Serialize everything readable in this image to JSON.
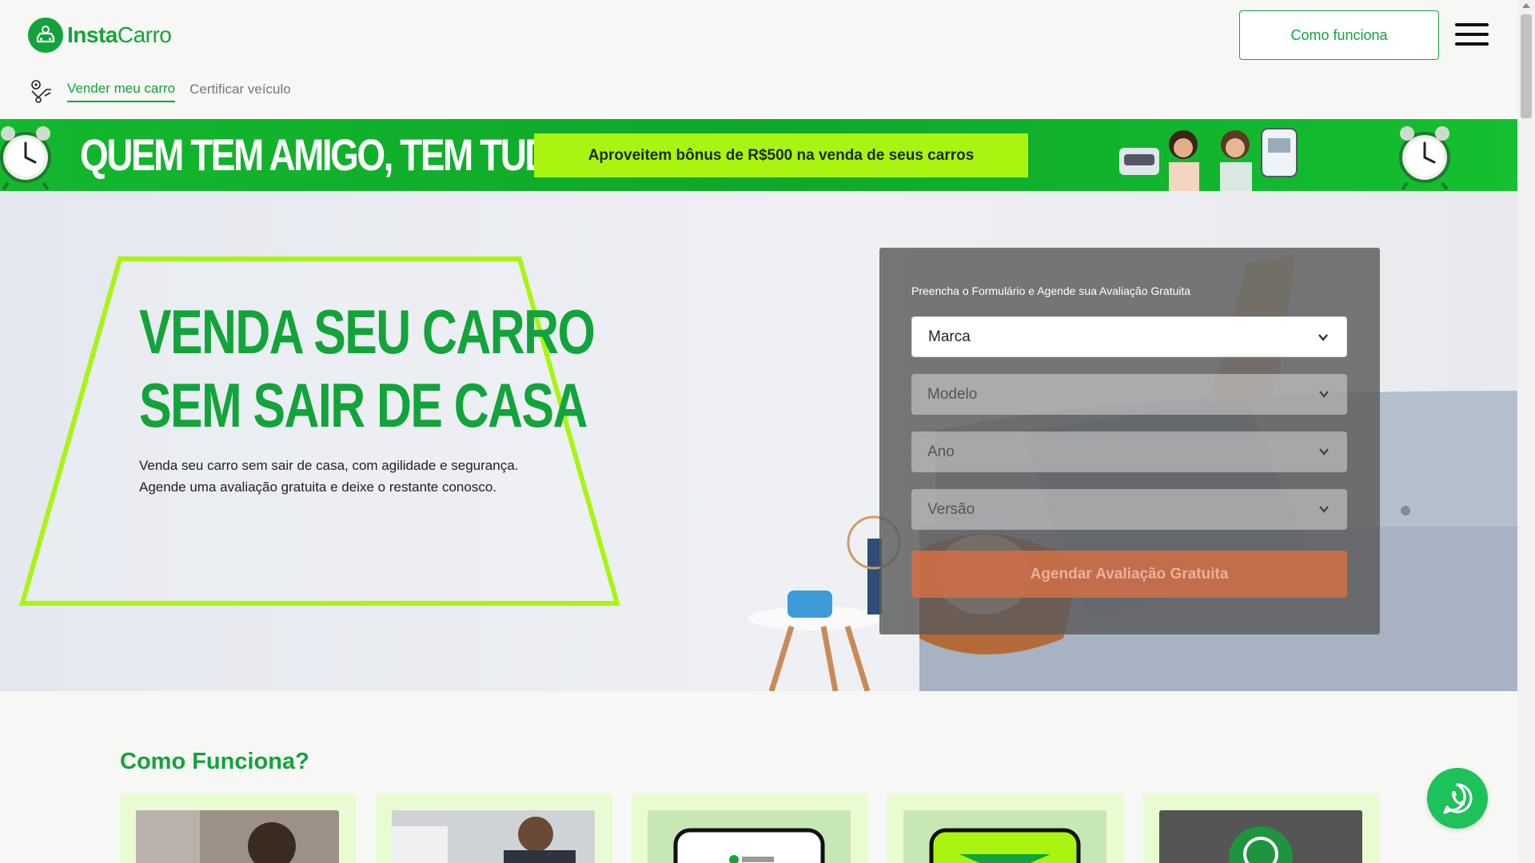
{
  "brand": {
    "name_bold": "Insta",
    "name_light": "Carro",
    "color": "#12a43a"
  },
  "header": {
    "how_button": "Como funciona",
    "menu_icon": "hamburger-menu-icon"
  },
  "subnav": {
    "items": [
      {
        "label": "Vender meu carro",
        "active": true
      },
      {
        "label": "Certificar veículo",
        "active": false
      }
    ]
  },
  "promo": {
    "title": "QUEM TEM AMIGO, TEM TUDO!",
    "cta": "Aproveitem bônus de R$500 na venda de seus carros",
    "accent": "#a9f511"
  },
  "hero": {
    "title_line1": "VENDA SEU CARRO",
    "title_line2": "SEM SAIR DE CASA",
    "subtitle_line1": "Venda seu carro sem sair de casa, com agilidade e segurança.",
    "subtitle_line2": "Agende uma avaliação gratuita e deixe o restante conosco."
  },
  "form": {
    "caption": "Preencha o Formulário e Agende sua Avaliação Gratuita",
    "selects": [
      {
        "label": "Marca",
        "enabled": true
      },
      {
        "label": "Modelo",
        "enabled": false
      },
      {
        "label": "Ano",
        "enabled": false
      },
      {
        "label": "Versão",
        "enabled": false
      }
    ],
    "submit": "Agendar Avaliação Gratuita"
  },
  "how_it_works": {
    "title": "Como Funciona?"
  },
  "colors": {
    "primary": "#12a43a",
    "lime": "#a9f511",
    "whatsapp": "#1dc25a"
  }
}
